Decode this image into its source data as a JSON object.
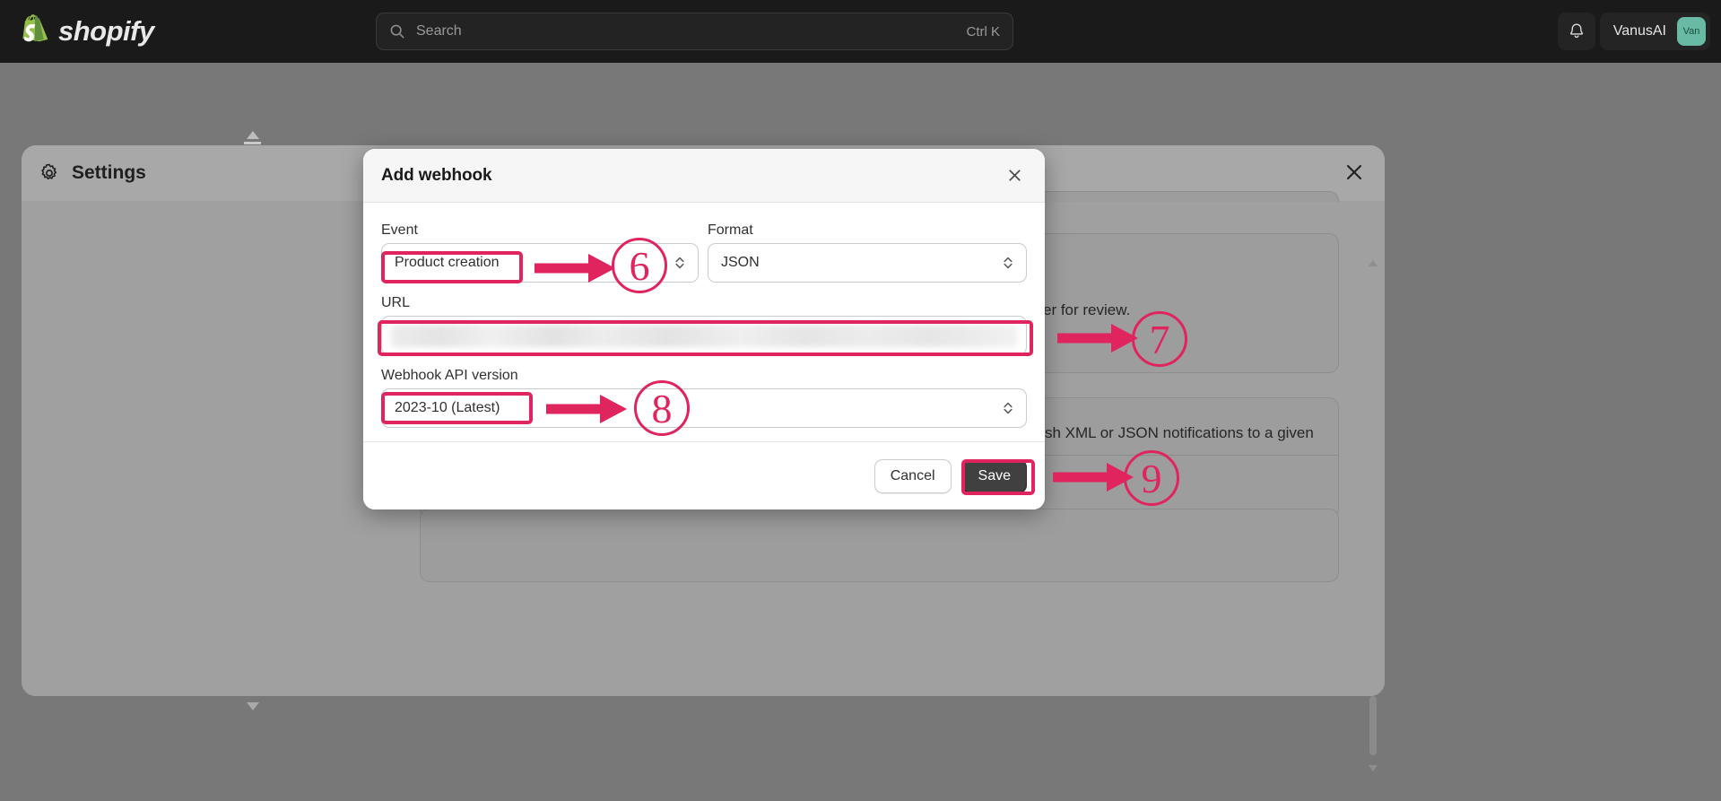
{
  "topbar": {
    "brand_name": "shopify",
    "brand_logo_icon": "shopify-bag-icon",
    "search": {
      "placeholder": "Search",
      "icon": "search-icon",
      "shortcut": "Ctrl K"
    },
    "notifications_icon": "bell-icon",
    "user_name": "VanusAI",
    "user_avatar_initials": "Van",
    "avatar_color": "#68baa4",
    "background_color": "#1a1a1a"
  },
  "settings_page": {
    "title": "Settings",
    "gear_icon": "gear-icon",
    "close_icon": "close-icon",
    "background_text_review": "er for review.",
    "background_text_push": "sh XML or JSON notifications to a given"
  },
  "modal": {
    "title": "Add webhook",
    "close_icon": "close-icon",
    "fields": {
      "event": {
        "label": "Event",
        "value": "Product creation",
        "chevron_icon": "chevron-updown-icon"
      },
      "format": {
        "label": "Format",
        "value": "JSON",
        "chevron_icon": "chevron-updown-icon"
      },
      "url": {
        "label": "URL",
        "value": "",
        "redacted": true
      },
      "api_version": {
        "label": "Webhook API version",
        "value": "2023-10 (Latest)",
        "chevron_icon": "chevron-updown-icon"
      }
    },
    "buttons": {
      "cancel": "Cancel",
      "save": "Save"
    }
  },
  "annotations": {
    "accent_color": "#e0245e",
    "steps": [
      {
        "number": "6",
        "target": "event-select"
      },
      {
        "number": "7",
        "target": "url-input"
      },
      {
        "number": "8",
        "target": "api-version-select"
      },
      {
        "number": "9",
        "target": "save-button"
      }
    ]
  }
}
